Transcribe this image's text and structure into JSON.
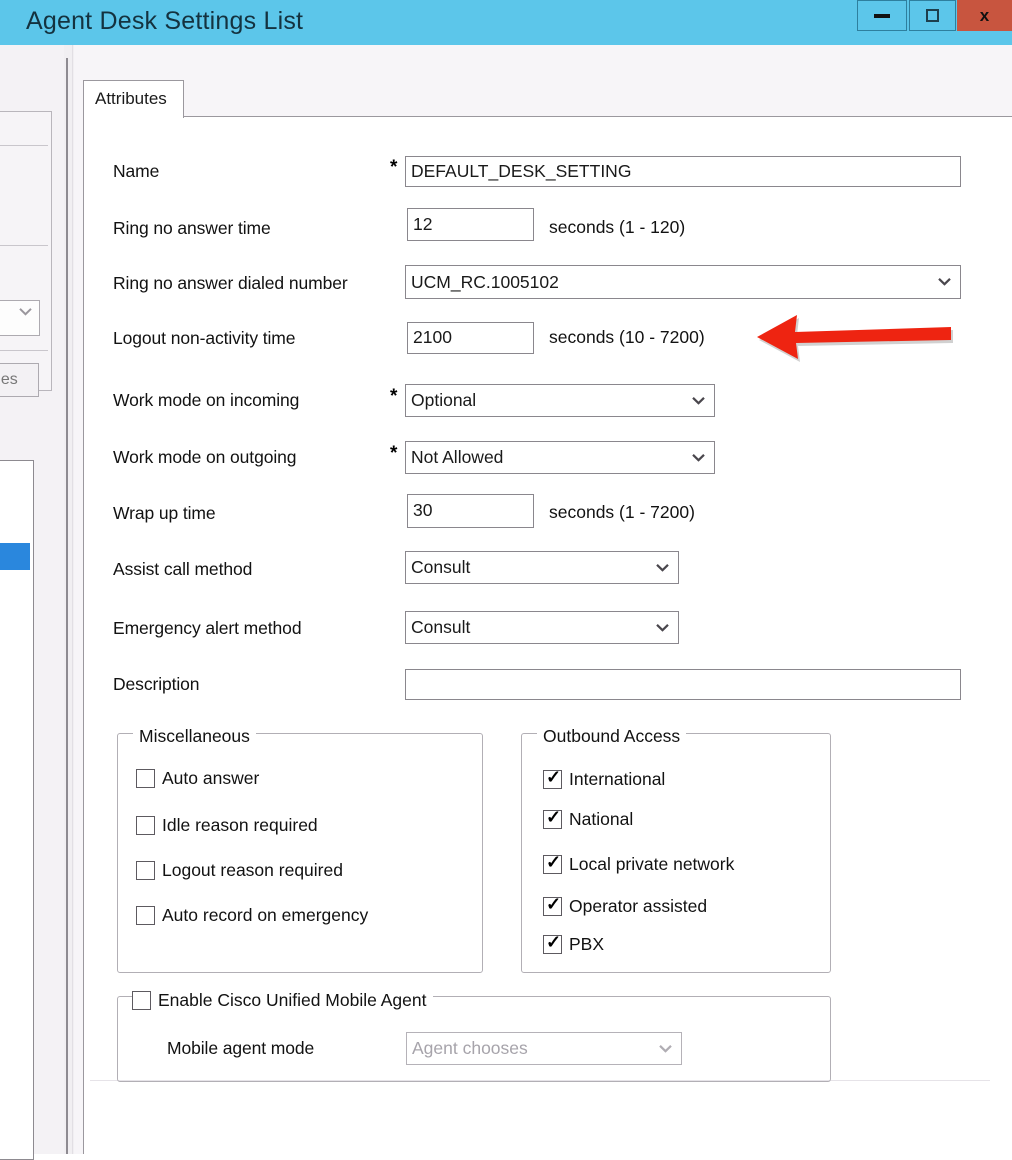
{
  "window": {
    "title": "Agent Desk Settings List",
    "controls": {
      "minimize_label": "",
      "maximize_label": "",
      "close_label": "x"
    },
    "colors": {
      "titlebar": "#5cc6ea",
      "close_button": "#c8553f",
      "selection_blue": "#2a87dd",
      "annotation_red": "#ee2411"
    }
  },
  "sidebar": {
    "combo_value": "",
    "button_label": "ges",
    "selected_row_label": ""
  },
  "tabs": [
    {
      "label": "Attributes",
      "selected": true
    }
  ],
  "form": {
    "fields": [
      {
        "label": "Name",
        "required": true,
        "control": "text",
        "value": "DEFAULT_DESK_SETTING",
        "suffix": ""
      },
      {
        "label": "Ring no answer time",
        "required": false,
        "control": "text",
        "value": "12",
        "suffix": "seconds (1 - 120)"
      },
      {
        "label": "Ring no answer dialed number",
        "required": false,
        "control": "select",
        "value": "UCM_RC.1005102",
        "suffix": ""
      },
      {
        "label": "Logout non-activity time",
        "required": false,
        "control": "text",
        "value": "2100",
        "suffix": "seconds (10 - 7200)"
      },
      {
        "label": "Work mode on incoming",
        "required": true,
        "control": "select",
        "value": "Optional",
        "suffix": ""
      },
      {
        "label": "Work mode on outgoing",
        "required": true,
        "control": "select",
        "value": "Not Allowed",
        "suffix": ""
      },
      {
        "label": "Wrap up time",
        "required": false,
        "control": "text",
        "value": "30",
        "suffix": "seconds (1 - 7200)"
      },
      {
        "label": "Assist call method",
        "required": false,
        "control": "select",
        "value": "Consult",
        "suffix": ""
      },
      {
        "label": "Emergency alert method",
        "required": false,
        "control": "select",
        "value": "Consult",
        "suffix": ""
      },
      {
        "label": "Description",
        "required": false,
        "control": "text",
        "value": "",
        "suffix": ""
      }
    ]
  },
  "miscellaneous": {
    "legend": "Miscellaneous",
    "items": [
      {
        "label": "Auto answer",
        "checked": false
      },
      {
        "label": "Idle reason required",
        "checked": false
      },
      {
        "label": "Logout reason required",
        "checked": false
      },
      {
        "label": "Auto record on emergency",
        "checked": false
      }
    ]
  },
  "outbound_access": {
    "legend": "Outbound Access",
    "items": [
      {
        "label": "International",
        "checked": true
      },
      {
        "label": "National",
        "checked": true
      },
      {
        "label": "Local private network",
        "checked": true
      },
      {
        "label": "Operator assisted",
        "checked": true
      },
      {
        "label": "PBX",
        "checked": true
      }
    ]
  },
  "mobile_agent": {
    "enable_label": "Enable Cisco Unified Mobile Agent",
    "enable_checked": false,
    "mode_label": "Mobile agent mode",
    "mode_value": "Agent chooses",
    "mode_disabled": true
  },
  "annotation": {
    "type": "arrow",
    "direction": "left",
    "points_at": "Logout non-activity time seconds (10 - 7200)"
  }
}
